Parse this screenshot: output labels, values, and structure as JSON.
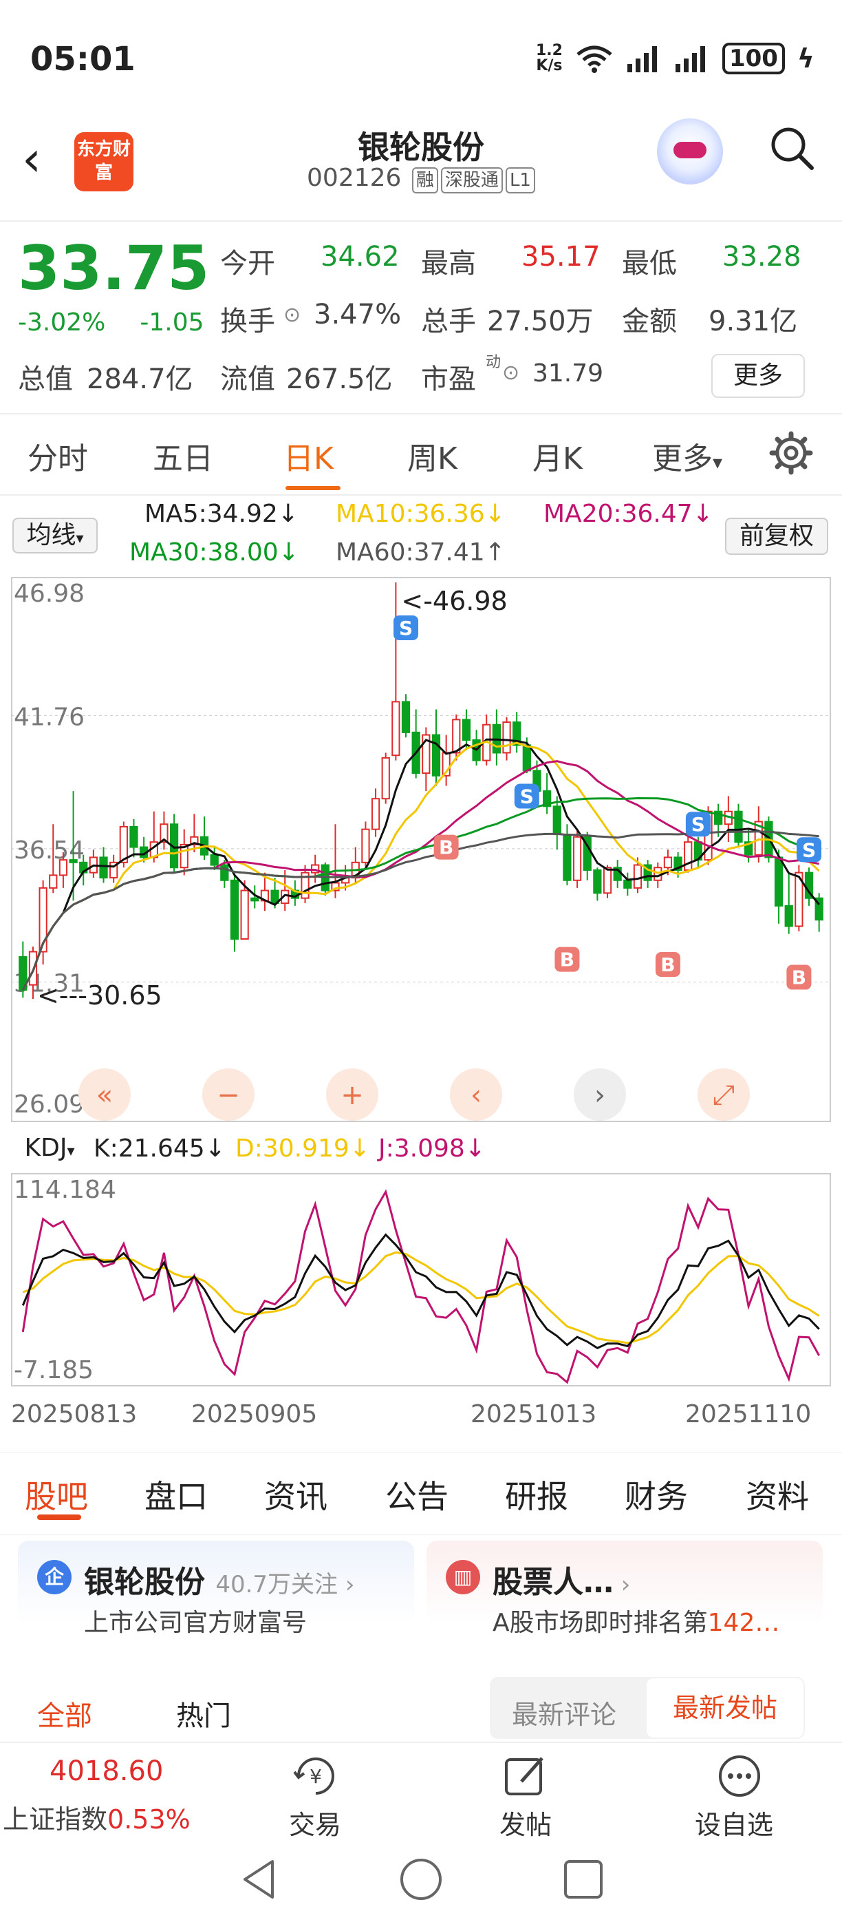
{
  "status_bar": {
    "time": "05:01",
    "net_speed_value": "1.2",
    "net_speed_unit": "K/s",
    "battery": "100"
  },
  "header": {
    "title": "银轮股份",
    "code": "002126",
    "tags": [
      "融",
      "深股通",
      "L1"
    ],
    "logo_text": "东方财富"
  },
  "quote": {
    "price": "33.75",
    "change_pct": "-3.02%",
    "change": "-1.05",
    "open_label": "今开",
    "open": "34.62",
    "high_label": "最高",
    "high": "35.17",
    "low_label": "最低",
    "low": "33.28",
    "turnover_label": "换手",
    "turnover": "3.47%",
    "volume_label": "总手",
    "volume": "27.50万",
    "amount_label": "金额",
    "amount": "9.31亿",
    "mktcap_label": "总值",
    "mktcap": "284.7亿",
    "float_label": "流值",
    "float_cap": "267.5亿",
    "pe_label": "市盈",
    "pe_sup": "动",
    "pe": "31.79",
    "more": "更多"
  },
  "period_tabs": [
    "分时",
    "五日",
    "日K",
    "周K",
    "月K",
    "更多"
  ],
  "active_period": "日K",
  "ma": {
    "selector": "均线",
    "ma5": "MA5:34.92↓",
    "ma10": "MA10:36.36↓",
    "ma20": "MA20:36.47↓",
    "ma30": "MA30:38.00↓",
    "ma60": "MA60:37.41↑",
    "adjust": "前复权"
  },
  "kdj": {
    "selector": "KDJ",
    "k": "K:21.645↓",
    "d": "D:30.919↓",
    "j": "J:3.098↓",
    "top": "114.184",
    "bottom": "-7.185"
  },
  "dates": [
    "20250813",
    "20250905",
    "20251013",
    "20251110"
  ],
  "chart_data": {
    "type": "candlestick",
    "y_ticks": [
      "46.98",
      "41.76",
      "36.54",
      "31.31",
      "26.09"
    ],
    "ylim": [
      26.09,
      46.98
    ],
    "annotations": {
      "max": "<-46.98",
      "min": "<---30.65"
    },
    "signal_marks": {
      "buy": "B",
      "sell": "S"
    },
    "series": [
      {
        "name": "MA5",
        "color": "#111111"
      },
      {
        "name": "MA10",
        "color": "#f2c600"
      },
      {
        "name": "MA20",
        "color": "#c0136f"
      },
      {
        "name": "MA30",
        "color": "#0a9a22"
      },
      {
        "name": "MA60",
        "color": "#555555"
      }
    ],
    "candles": [
      [
        32.3,
        31.0,
        32.9,
        30.7
      ],
      [
        31.2,
        32.5,
        32.7,
        30.65
      ],
      [
        32.5,
        35.0,
        35.3,
        32.0
      ],
      [
        35.0,
        35.5,
        37.5,
        34.8
      ],
      [
        35.5,
        36.1,
        36.4,
        35.0
      ],
      [
        36.1,
        36.0,
        38.8,
        34.5
      ],
      [
        36.0,
        35.6,
        36.3,
        35.1
      ],
      [
        35.6,
        36.2,
        36.5,
        35.4
      ],
      [
        36.2,
        35.4,
        36.6,
        35.2
      ],
      [
        35.4,
        36.0,
        36.3,
        35.2
      ],
      [
        36.0,
        37.4,
        37.6,
        35.8
      ],
      [
        37.4,
        36.6,
        37.7,
        36.2
      ],
      [
        36.6,
        36.2,
        37.0,
        36.0
      ],
      [
        36.2,
        36.8,
        38.0,
        36.0
      ],
      [
        36.8,
        37.5,
        38.0,
        36.5
      ],
      [
        37.5,
        35.8,
        37.9,
        35.6
      ],
      [
        35.8,
        36.7,
        37.3,
        35.5
      ],
      [
        36.7,
        37.0,
        37.9,
        36.4
      ],
      [
        37.0,
        36.3,
        37.8,
        36.1
      ],
      [
        36.3,
        35.9,
        36.6,
        35.7
      ],
      [
        35.9,
        35.3,
        36.1,
        35.0
      ],
      [
        35.3,
        33.0,
        35.5,
        32.5
      ],
      [
        33.0,
        34.9,
        35.3,
        33.6
      ],
      [
        34.6,
        34.5,
        35.1,
        34.2
      ],
      [
        34.5,
        34.9,
        35.6,
        34.1
      ],
      [
        34.9,
        34.4,
        35.4,
        34.2
      ],
      [
        34.4,
        34.9,
        35.7,
        34.1
      ],
      [
        34.9,
        34.6,
        35.3,
        34.3
      ],
      [
        34.6,
        35.6,
        35.9,
        34.4
      ],
      [
        35.6,
        35.9,
        36.3,
        35.2
      ],
      [
        35.9,
        34.9,
        36.0,
        34.7
      ],
      [
        34.9,
        35.2,
        37.5,
        34.6
      ],
      [
        35.2,
        35.4,
        35.9,
        34.9
      ],
      [
        35.4,
        36.0,
        36.6,
        35.2
      ],
      [
        36.0,
        37.3,
        37.6,
        35.8
      ],
      [
        37.3,
        38.5,
        38.9,
        37.0
      ],
      [
        38.5,
        40.1,
        40.3,
        38.3
      ],
      [
        40.2,
        42.3,
        46.98,
        40.0
      ],
      [
        42.3,
        41.1,
        42.6,
        40.9
      ],
      [
        41.1,
        39.5,
        42.0,
        39.3
      ],
      [
        39.5,
        41.0,
        41.3,
        38.8
      ],
      [
        41.0,
        39.4,
        42.0,
        39.0
      ],
      [
        39.4,
        40.3,
        41.0,
        39.0
      ],
      [
        40.3,
        41.6,
        41.8,
        40.0
      ],
      [
        41.6,
        40.8,
        42.0,
        40.4
      ],
      [
        40.8,
        40.0,
        41.2,
        39.8
      ],
      [
        40.0,
        41.4,
        41.8,
        39.8
      ],
      [
        41.4,
        40.3,
        42.0,
        39.8
      ],
      [
        40.3,
        41.5,
        41.7,
        40.0
      ],
      [
        41.5,
        40.6,
        41.9,
        40.3
      ],
      [
        40.6,
        39.6,
        40.9,
        39.5
      ],
      [
        39.6,
        38.8,
        40.0,
        38.6
      ],
      [
        38.8,
        38.2,
        39.5,
        37.9
      ],
      [
        38.2,
        37.1,
        38.6,
        36.5
      ],
      [
        37.1,
        35.3,
        37.5,
        35.1
      ],
      [
        35.3,
        37.0,
        37.3,
        35.0
      ],
      [
        37.0,
        35.7,
        37.2,
        35.3
      ],
      [
        35.7,
        34.8,
        35.8,
        34.5
      ],
      [
        34.8,
        35.8,
        35.9,
        34.6
      ],
      [
        35.8,
        35.3,
        36.1,
        35.0
      ],
      [
        35.3,
        35.0,
        35.6,
        34.7
      ],
      [
        35.0,
        35.9,
        36.2,
        34.8
      ],
      [
        35.9,
        35.3,
        36.1,
        35.0
      ],
      [
        35.3,
        35.8,
        36.0,
        35.0
      ],
      [
        35.8,
        36.2,
        36.5,
        35.5
      ],
      [
        36.2,
        35.7,
        36.4,
        35.4
      ],
      [
        35.7,
        36.8,
        37.0,
        35.6
      ],
      [
        36.8,
        36.1,
        37.0,
        35.8
      ],
      [
        36.1,
        38.0,
        38.2,
        35.9
      ],
      [
        38.0,
        37.5,
        38.3,
        37.0
      ],
      [
        37.5,
        38.0,
        38.6,
        36.8
      ],
      [
        38.0,
        36.8,
        38.3,
        36.6
      ],
      [
        36.8,
        36.3,
        37.3,
        36.0
      ],
      [
        36.3,
        37.6,
        38.2,
        36.0
      ],
      [
        37.6,
        36.2,
        37.8,
        36.0
      ],
      [
        36.2,
        34.3,
        36.5,
        33.6
      ],
      [
        34.3,
        33.5,
        35.6,
        33.2
      ],
      [
        33.5,
        35.6,
        35.9,
        33.3
      ],
      [
        35.6,
        34.6,
        35.8,
        34.3
      ],
      [
        34.6,
        33.75,
        34.8,
        33.28
      ]
    ]
  },
  "bottom_tabs": [
    "股吧",
    "盘口",
    "资讯",
    "公告",
    "研报",
    "财务",
    "资料"
  ],
  "card1": {
    "icon": "企",
    "title": "银轮股份",
    "follow": "40.7万关注",
    "sub": "上市公司官方财富号"
  },
  "card2": {
    "title": "股票人…",
    "sub_prefix": "A股市场即时排名第",
    "sub_value": "142…"
  },
  "filters": {
    "all": "全部",
    "hot": "热门",
    "latest_comment": "最新评论",
    "latest_post": "最新发帖"
  },
  "bottom_bar": {
    "index_value": "4018.60",
    "index_name": "上证指数",
    "index_change": "0.53%",
    "trade": "交易",
    "post": "发帖",
    "watch": "设自选"
  }
}
